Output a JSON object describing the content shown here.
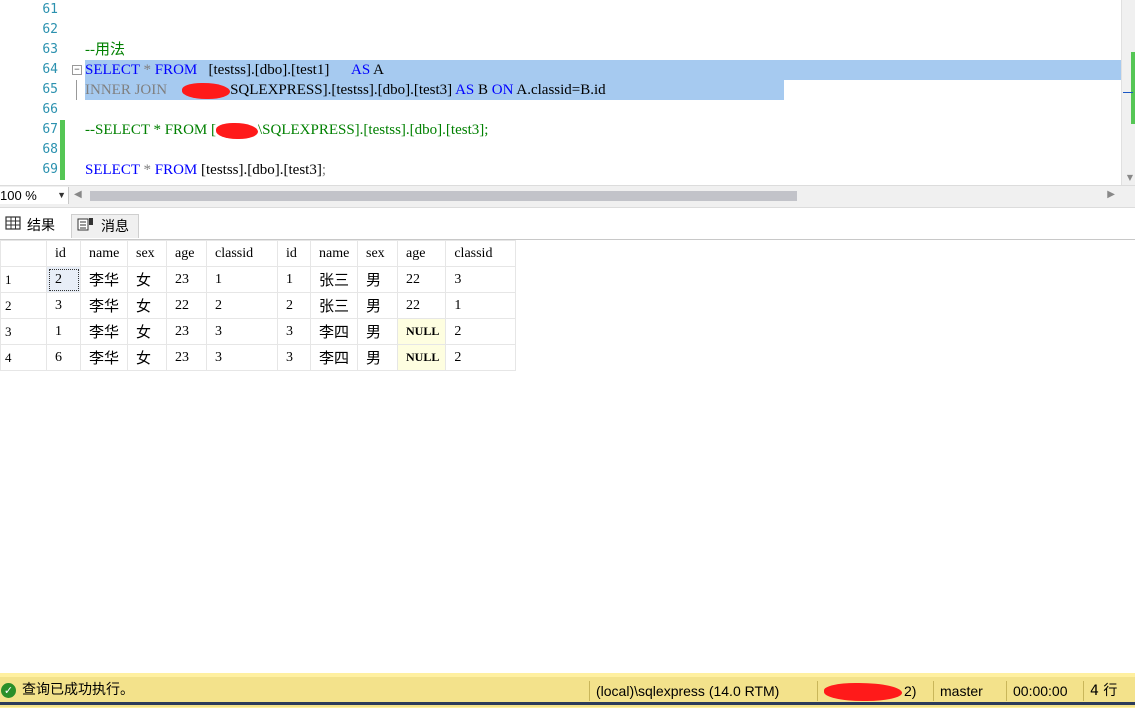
{
  "editor": {
    "lines": [
      {
        "num": "61",
        "text": ""
      },
      {
        "num": "62",
        "text": ""
      },
      {
        "num": "63",
        "text": "--用法"
      },
      {
        "num": "64",
        "p1": "SELECT",
        "p2": " * ",
        "p3": "FROM",
        "p4": "   [testss].[dbo].[test1]      ",
        "p5": "AS",
        "p6": " A"
      },
      {
        "num": "65",
        "p1": "INNER JOIN",
        "p4": "SQLEXPRESS].[testss].[dbo].[test3] ",
        "p5": "AS",
        "p6": " B ",
        "p7": "ON",
        "p8": " A.classid=B.id"
      },
      {
        "num": "66",
        "text": ""
      },
      {
        "num": "67",
        "p1": "--SELECT * FROM [",
        "p4": "\\SQLEXPRESS].[testss].[dbo].[test3];"
      },
      {
        "num": "68",
        "text": ""
      },
      {
        "num": "69",
        "p1": "SELECT",
        "p2": " * ",
        "p3": "FROM",
        "p4": " [testss].[dbo].[test3]",
        "p5": ";"
      }
    ]
  },
  "zoom": {
    "value": "100 %"
  },
  "tabs": {
    "results": {
      "icon": "grid-icon",
      "label": "结果"
    },
    "messages": {
      "icon": "message-icon",
      "label": "消息"
    }
  },
  "grid": {
    "columns": [
      "",
      "id",
      "name",
      "sex",
      "age",
      "classid",
      "id",
      "name",
      "sex",
      "age",
      "classid"
    ],
    "rows": [
      [
        "1",
        "2",
        "李华",
        "女",
        "23",
        "1",
        "1",
        "张三",
        "男",
        "22",
        "3"
      ],
      [
        "2",
        "3",
        "李华",
        "女",
        "22",
        "2",
        "2",
        "张三",
        "男",
        "22",
        "1"
      ],
      [
        "3",
        "1",
        "李华",
        "女",
        "23",
        "3",
        "3",
        "李四",
        "男",
        "NULL",
        "2"
      ],
      [
        "4",
        "6",
        "李华",
        "女",
        "23",
        "3",
        "3",
        "李四",
        "男",
        "NULL",
        "2"
      ]
    ]
  },
  "status": {
    "message": "查询已成功执行。",
    "server": "(local)\\sqlexpress (14.0 RTM)",
    "user": "2)",
    "database": "master",
    "elapsed": "00:00:00",
    "rows": "4 行"
  },
  "colors": {
    "selection": "#a6caf0",
    "keyword": "#0000ff",
    "comment": "#008000",
    "status_bar": "#f3e28b",
    "null_cell": "#fefee0"
  }
}
